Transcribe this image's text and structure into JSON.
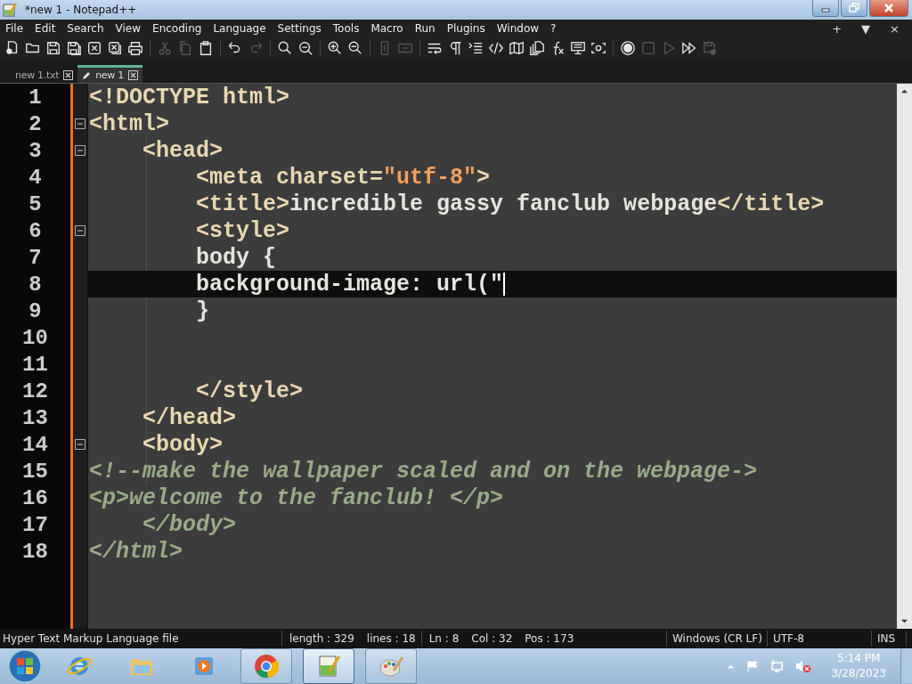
{
  "window": {
    "title": "*new 1 - Notepad++"
  },
  "menu": {
    "items": [
      "File",
      "Edit",
      "Search",
      "View",
      "Encoding",
      "Language",
      "Settings",
      "Tools",
      "Macro",
      "Run",
      "Plugins",
      "Window",
      "?"
    ],
    "right": [
      "+",
      "▼",
      "×"
    ]
  },
  "toolbar": [
    {
      "disabled": false
    },
    {
      "disabled": false
    },
    {
      "disabled": false
    },
    {
      "disabled": false
    },
    {
      "disabled": false
    },
    {
      "disabled": false
    },
    {
      "disabled": false
    },
    {
      "disabled": true
    },
    {
      "disabled": true
    },
    {
      "disabled": false
    },
    {
      "disabled": false
    },
    {
      "disabled": true
    },
    {
      "disabled": false
    },
    {
      "disabled": false
    },
    {
      "disabled": false
    },
    {
      "disabled": false
    },
    {
      "disabled": true
    },
    {
      "disabled": true
    },
    {
      "disabled": false
    },
    {
      "disabled": false
    },
    {
      "disabled": false
    },
    {
      "disabled": false
    },
    {
      "disabled": false
    },
    {
      "disabled": false
    },
    {
      "disabled": false
    },
    {
      "disabled": false
    },
    {
      "disabled": false
    },
    {
      "disabled": false
    },
    {
      "disabled": true
    },
    {
      "disabled": true
    },
    {
      "disabled": false
    },
    {
      "disabled": true
    }
  ],
  "tabs": [
    {
      "label": "new 1.txt",
      "selected": false
    },
    {
      "label": "new 1",
      "selected": true
    }
  ],
  "editor": {
    "lines": [
      {
        "number": "1",
        "fold": false,
        "current": false,
        "tokens": [
          {
            "kind": "tag",
            "text": "<!DOCTYPE html>"
          }
        ]
      },
      {
        "number": "2",
        "fold": true,
        "current": false,
        "tokens": [
          {
            "kind": "tag",
            "text": "<html>"
          }
        ]
      },
      {
        "number": "3",
        "fold": true,
        "current": false,
        "tokens": [
          {
            "kind": "tag",
            "text": "    <head>"
          }
        ]
      },
      {
        "number": "4",
        "fold": false,
        "current": false,
        "tokens": [
          {
            "kind": "tag",
            "text": "        <meta charset="
          },
          {
            "kind": "string",
            "text": "\"utf-8\""
          },
          {
            "kind": "tag",
            "text": ">"
          }
        ]
      },
      {
        "number": "5",
        "fold": false,
        "current": false,
        "tokens": [
          {
            "kind": "tag",
            "text": "        <title>"
          },
          {
            "kind": "text",
            "text": "incredible gassy fanclub webpage"
          },
          {
            "kind": "tag",
            "text": "</title>"
          }
        ]
      },
      {
        "number": "6",
        "fold": true,
        "current": false,
        "tokens": [
          {
            "kind": "tag",
            "text": "        <style>"
          }
        ]
      },
      {
        "number": "7",
        "fold": false,
        "current": false,
        "tokens": [
          {
            "kind": "text",
            "text": "        body {"
          }
        ]
      },
      {
        "number": "8",
        "fold": false,
        "current": true,
        "tokens": [
          {
            "kind": "text",
            "text": "        background-image: url(\""
          }
        ]
      },
      {
        "number": "9",
        "fold": false,
        "current": false,
        "tokens": [
          {
            "kind": "text",
            "text": "        }"
          }
        ]
      },
      {
        "number": "10",
        "fold": false,
        "current": false
      },
      {
        "number": "11",
        "fold": false,
        "current": false
      },
      {
        "number": "12",
        "fold": false,
        "current": false,
        "tokens": [
          {
            "kind": "tag",
            "text": "        </style>"
          }
        ]
      },
      {
        "number": "13",
        "fold": false,
        "current": false,
        "tokens": [
          {
            "kind": "tag",
            "text": "    </head>"
          }
        ]
      },
      {
        "number": "14",
        "fold": true,
        "current": false,
        "tokens": [
          {
            "kind": "tag",
            "text": "    <body>"
          }
        ]
      },
      {
        "number": "15",
        "fold": false,
        "current": false,
        "tokens": [
          {
            "kind": "comment",
            "text": "<!--make the wallpaper scaled and on the webpage->"
          }
        ]
      },
      {
        "number": "16",
        "fold": false,
        "current": false,
        "tokens": [
          {
            "kind": "comment",
            "text": "<p>welcome to the fanclub! </p>"
          }
        ]
      },
      {
        "number": "17",
        "fold": false,
        "current": false,
        "tokens": [
          {
            "kind": "comment",
            "text": "    </body>"
          }
        ]
      },
      {
        "number": "18",
        "fold": false,
        "current": false,
        "tokens": [
          {
            "kind": "comment",
            "text": "</html>"
          }
        ]
      }
    ]
  },
  "status_bar": {
    "language": "Hyper Text Markup Language file",
    "length": "length : 329",
    "lines": "lines : 18",
    "ln": "Ln : 8",
    "col": "Col : 32",
    "pos": "Pos : 173",
    "eol": "Windows (CR LF)",
    "encoding": "UTF-8",
    "mode": "INS"
  },
  "taskbar": {
    "apps": [
      {
        "running": false,
        "active": false
      },
      {
        "running": false,
        "active": false
      },
      {
        "running": false,
        "active": false
      },
      {
        "running": true,
        "active": false
      },
      {
        "running": true,
        "active": true
      },
      {
        "running": true,
        "active": false
      }
    ],
    "time": "5:14 PM",
    "date": "3/28/2023"
  }
}
